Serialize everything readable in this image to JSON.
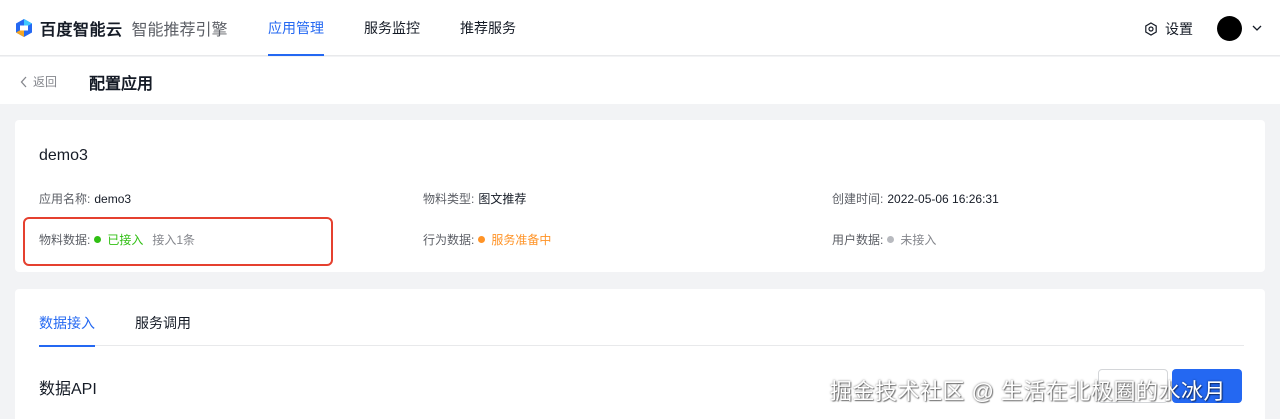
{
  "brand": {
    "name": "百度智能云",
    "product": "智能推荐引擎"
  },
  "nav": {
    "items": [
      {
        "label": "应用管理",
        "active": true
      },
      {
        "label": "服务监控",
        "active": false
      },
      {
        "label": "推荐服务",
        "active": false
      }
    ],
    "settings_label": "设置"
  },
  "breadcrumb": {
    "back_label": "返回",
    "title": "配置应用"
  },
  "app": {
    "name": "demo3",
    "fields": {
      "app_name": {
        "label": "应用名称:",
        "value": "demo3"
      },
      "material_type": {
        "label": "物料类型:",
        "value": "图文推荐"
      },
      "created_time": {
        "label": "创建时间:",
        "value": "2022-05-06 16:26:31"
      },
      "material_data": {
        "label": "物料数据:",
        "status": "已接入",
        "extra": "接入1条"
      },
      "behavior_data": {
        "label": "行为数据:",
        "status": "服务准备中"
      },
      "user_data": {
        "label": "用户数据:",
        "status": "未接入"
      }
    }
  },
  "tabs": [
    {
      "label": "数据接入",
      "active": true
    },
    {
      "label": "服务调用",
      "active": false
    }
  ],
  "section": {
    "title": "数据API"
  },
  "watermark": "掘金技术社区 @ 生活在北极圈的水冰月",
  "colors": {
    "accent": "#2468f2",
    "status_green": "#30bf13",
    "status_orange": "#ff9326",
    "status_gray": "#b8babf",
    "highlight_red": "#e5402f"
  },
  "icons": [
    "baidu-cloud-logo-icon",
    "settings-gear-icon",
    "chevron-down-icon",
    "chevron-left-icon"
  ]
}
